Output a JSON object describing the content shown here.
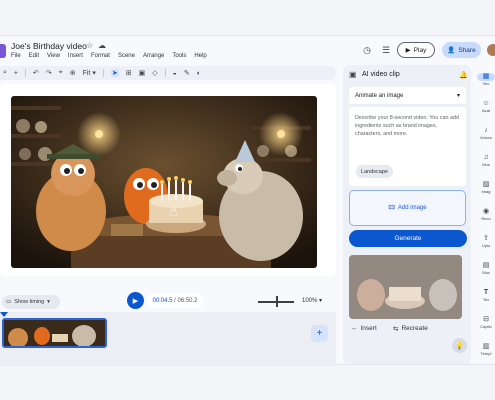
{
  "header": {
    "doc_title": "Joe's Birthday video",
    "menu": [
      "File",
      "Edit",
      "View",
      "Insert",
      "Format",
      "Scene",
      "Arrange",
      "Tools",
      "Help"
    ],
    "play_label": "Play",
    "share_label": "Share"
  },
  "toolbar": {
    "fit_label": "Fit"
  },
  "playback": {
    "show_timing": "Show timing",
    "current_time": "00:04.5",
    "separator": " / ",
    "total_time": "06:50.2",
    "zoom": "100%"
  },
  "panel": {
    "title": "AI video clip",
    "mode": "Animate an image",
    "prompt_placeholder": "Describe your 8-second video. You can add ingredients such as brand images, characters, and more.",
    "aspect_chip": "Landscape",
    "add_image": "Add image",
    "generate": "Generate",
    "insert": "Insert",
    "recreate": "Recreate"
  },
  "rail": {
    "items": [
      {
        "label": "Vec",
        "icon": "video-icon",
        "active": true
      },
      {
        "label": "Avat",
        "icon": "avatar-icon",
        "active": false
      },
      {
        "label": "Voiceo",
        "icon": "voiceover-icon",
        "active": false
      },
      {
        "label": "Mus",
        "icon": "music-icon",
        "active": false
      },
      {
        "label": "Imag",
        "icon": "image-icon",
        "active": false
      },
      {
        "label": "Reco",
        "icon": "record-icon",
        "active": false
      },
      {
        "label": "Uplo",
        "icon": "upload-icon",
        "active": false
      },
      {
        "label": "Stoc",
        "icon": "stock-icon",
        "active": false
      },
      {
        "label": "Tex",
        "icon": "text-icon",
        "active": false
      },
      {
        "label": "Captio",
        "icon": "captions-icon",
        "active": false
      },
      {
        "label": "Templ",
        "icon": "templates-icon",
        "active": false
      }
    ]
  },
  "colors": {
    "accent": "#0b57d0",
    "share_bg": "#c9dbfc",
    "brand": "#7a55d8"
  }
}
